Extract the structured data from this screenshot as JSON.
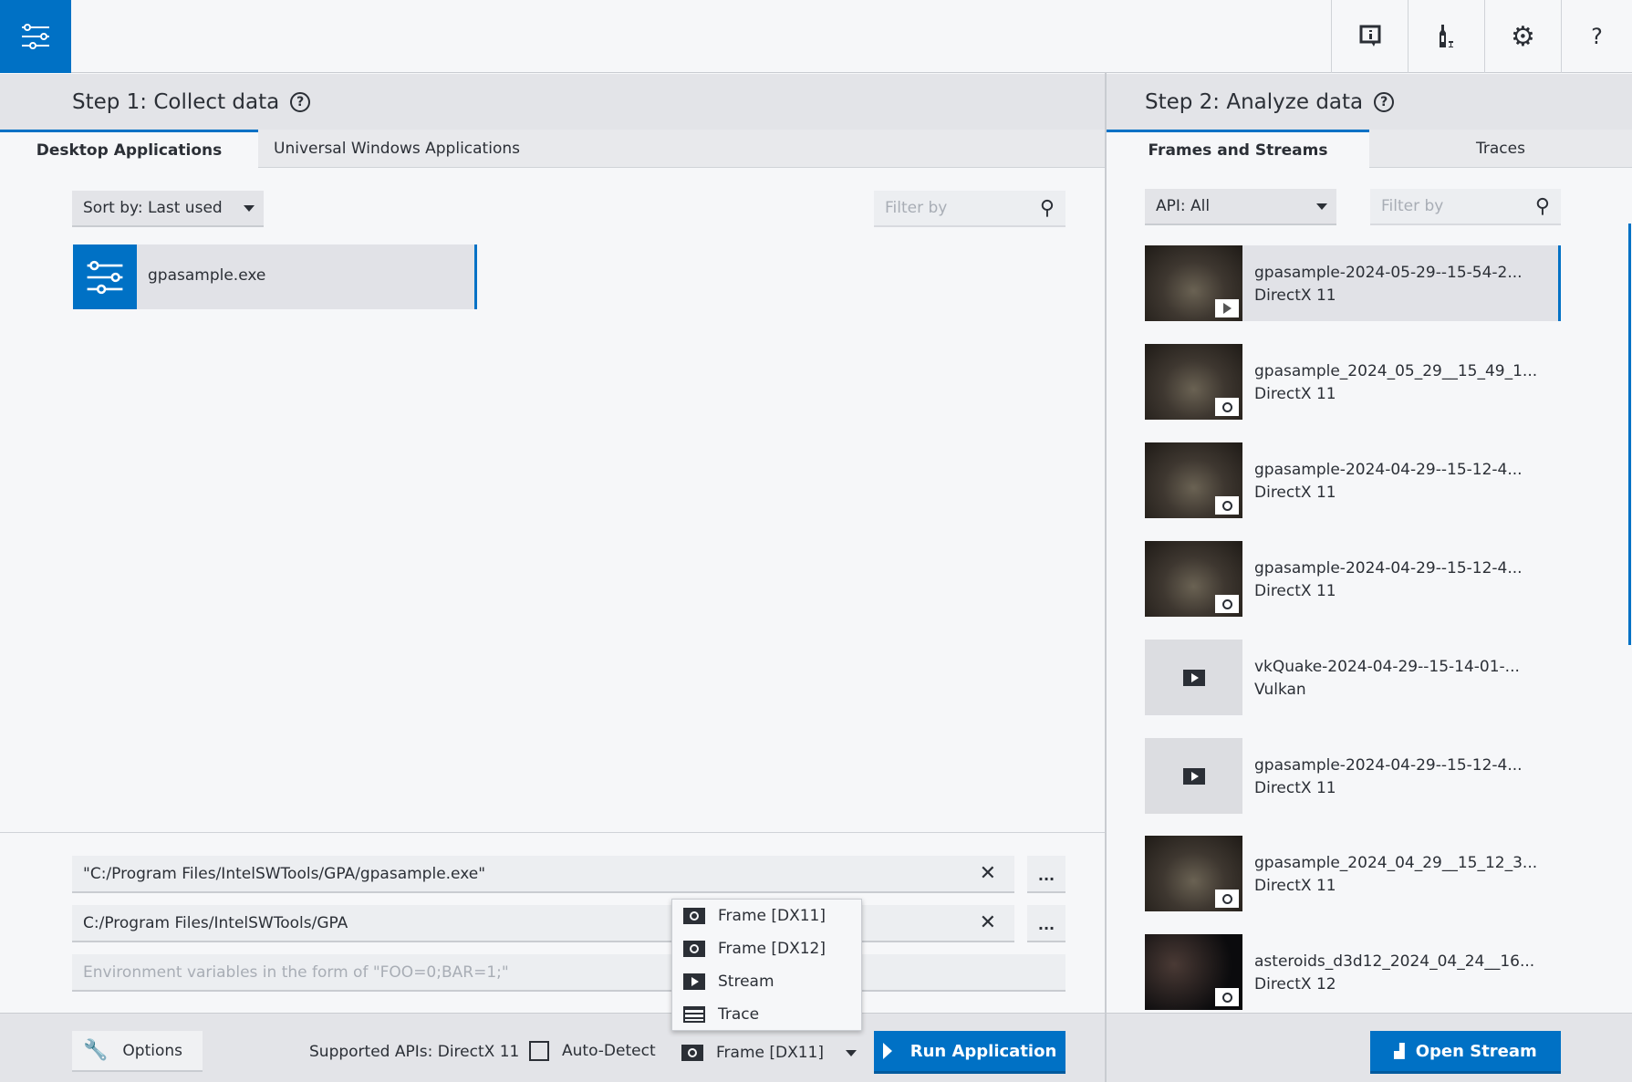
{
  "toolbar": {
    "menu": "menu-icon",
    "icons": [
      "feedback-icon",
      "bottle-icon",
      "gear-icon"
    ],
    "help": "?"
  },
  "left": {
    "title": "Step 1: Collect data",
    "help": "?",
    "tabs": [
      "Desktop Applications",
      "Universal Windows Applications"
    ],
    "sort": "Sort by: Last used",
    "filter_placeholder": "Filter by",
    "apps": [
      {
        "name": "gpasample.exe"
      }
    ],
    "command": "\"C:/Program Files/IntelSWTools/GPA/gpasample.exe\"",
    "working_dir": "C:/Program Files/IntelSWTools/GPA",
    "env_placeholder": "Environment variables in the form of \"FOO=0;BAR=1;\"",
    "browse": "...",
    "options": "Options",
    "supported": "Supported APIs: DirectX 11",
    "autodetect": "Auto-Detect",
    "mode": "Frame [DX11]",
    "run": "Run Application",
    "mode_options": [
      "Frame [DX11]",
      "Frame [DX12]",
      "Stream",
      "Trace"
    ]
  },
  "right": {
    "title": "Step 2: Analyze data",
    "help": "?",
    "tabs": [
      "Frames and Streams",
      "Traces"
    ],
    "api": "API: All",
    "filter_placeholder": "Filter by",
    "items": [
      {
        "name": "gpasample-2024-05-29--15-54-2...",
        "api": "DirectX 11",
        "kind": "stream"
      },
      {
        "name": "gpasample_2024_05_29__15_49_1...",
        "api": "DirectX 11",
        "kind": "frame"
      },
      {
        "name": "gpasample-2024-04-29--15-12-4...",
        "api": "DirectX 11",
        "kind": "frame"
      },
      {
        "name": "gpasample-2024-04-29--15-12-4...",
        "api": "DirectX 11",
        "kind": "frame"
      },
      {
        "name": "vkQuake-2024-04-29--15-14-01-...",
        "api": "Vulkan",
        "kind": "stream-noimg"
      },
      {
        "name": "gpasample-2024-04-29--15-12-4...",
        "api": "DirectX 11",
        "kind": "stream-noimg"
      },
      {
        "name": "gpasample_2024_04_29__15_12_3...",
        "api": "DirectX 11",
        "kind": "frame"
      },
      {
        "name": "asteroids_d3d12_2024_04_24__16...",
        "api": "DirectX 12",
        "kind": "frame-space"
      }
    ],
    "open": "Open Stream"
  },
  "colors": {
    "accent": "#0071c5"
  }
}
